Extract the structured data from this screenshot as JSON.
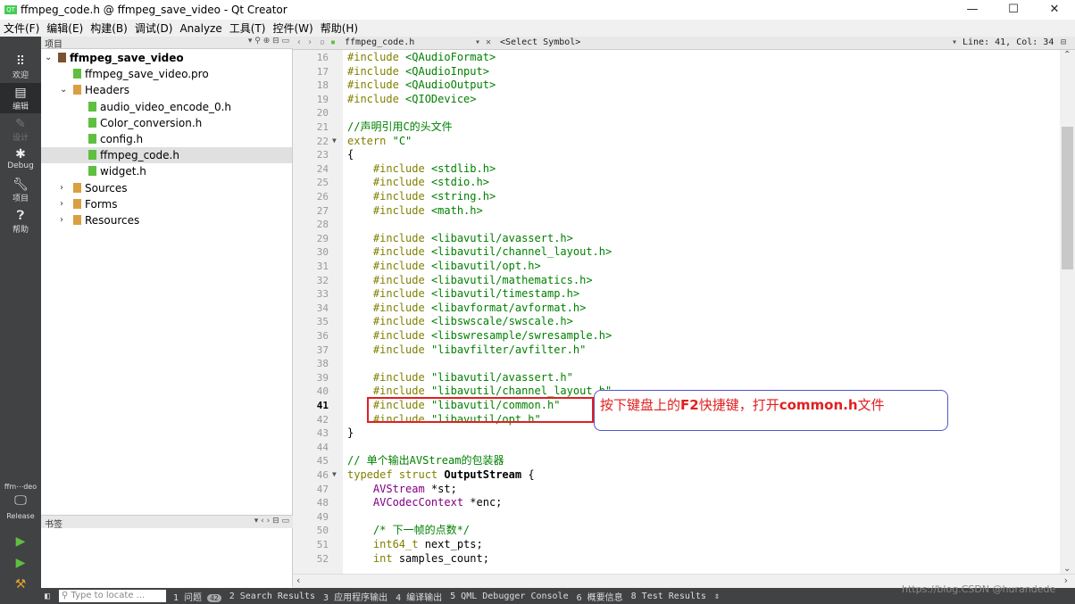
{
  "window": {
    "title": "ffmpeg_code.h @ ffmpeg_save_video - Qt Creator",
    "controls": [
      "—",
      "☐",
      "✕"
    ]
  },
  "menu": [
    "文件(F)",
    "编辑(E)",
    "构建(B)",
    "调试(D)",
    "Analyze",
    "工具(T)",
    "控件(W)",
    "帮助(H)"
  ],
  "modes": [
    {
      "label": "欢迎",
      "icon": "grid-icon"
    },
    {
      "label": "编辑",
      "icon": "edit-icon"
    },
    {
      "label": "设计",
      "icon": "design-icon"
    },
    {
      "label": "Debug",
      "icon": "bug-icon"
    },
    {
      "label": "项目",
      "icon": "wrench-icon"
    },
    {
      "label": "帮助",
      "icon": "help-icon"
    }
  ],
  "kit": {
    "project": "ffm⋯deo",
    "config": "Release"
  },
  "project_panel": {
    "title": "项目"
  },
  "tree": [
    {
      "label": "ffmpeg_save_video",
      "level": 0,
      "arrow": "⌄",
      "bold": true,
      "icon": "project-icon"
    },
    {
      "label": "ffmpeg_save_video.pro",
      "level": 1,
      "arrow": "",
      "icon": "pro-file-icon"
    },
    {
      "label": "Headers",
      "level": 1,
      "arrow": "⌄",
      "icon": "folder-icon"
    },
    {
      "label": "audio_video_encode_0.h",
      "level": 2,
      "arrow": "",
      "icon": "header-file-icon"
    },
    {
      "label": "Color_conversion.h",
      "level": 2,
      "arrow": "",
      "icon": "header-file-icon"
    },
    {
      "label": "config.h",
      "level": 2,
      "arrow": "",
      "icon": "header-file-icon"
    },
    {
      "label": "ffmpeg_code.h",
      "level": 2,
      "arrow": "",
      "icon": "header-file-icon",
      "selected": true
    },
    {
      "label": "widget.h",
      "level": 2,
      "arrow": "",
      "icon": "header-file-icon"
    },
    {
      "label": "Sources",
      "level": 1,
      "arrow": "›",
      "icon": "folder-icon"
    },
    {
      "label": "Forms",
      "level": 1,
      "arrow": "›",
      "icon": "folder-icon"
    },
    {
      "label": "Resources",
      "level": 1,
      "arrow": "›",
      "icon": "folder-icon"
    }
  ],
  "open_docs_panel": {
    "title": "书签"
  },
  "editor": {
    "filename": "ffmpeg_code.h",
    "symbol": "<Select Symbol>",
    "position": "Line: 41, Col: 34",
    "current_line": 41
  },
  "code_lines": [
    {
      "n": "16",
      "html": "<span class='kw'>#include</span> <span class='st'>&lt;QAudioFormat&gt;</span>"
    },
    {
      "n": "17",
      "html": "<span class='kw'>#include</span> <span class='st'>&lt;QAudioInput&gt;</span>"
    },
    {
      "n": "18",
      "html": "<span class='kw'>#include</span> <span class='st'>&lt;QAudioOutput&gt;</span>"
    },
    {
      "n": "19",
      "html": "<span class='kw'>#include</span> <span class='st'>&lt;QIODevice&gt;</span>"
    },
    {
      "n": "20",
      "html": ""
    },
    {
      "n": "21",
      "html": "<span class='cm'>//声明引用C的头文件</span>"
    },
    {
      "n": "22",
      "html": "<span class='kw'>extern</span> <span class='st'>\"C\"</span>",
      "fold": true
    },
    {
      "n": "23",
      "html": "{"
    },
    {
      "n": "24",
      "html": "    <span class='kw'>#include</span> <span class='st'>&lt;stdlib.h&gt;</span>"
    },
    {
      "n": "25",
      "html": "    <span class='kw'>#include</span> <span class='st'>&lt;stdio.h&gt;</span>"
    },
    {
      "n": "26",
      "html": "    <span class='kw'>#include</span> <span class='st'>&lt;string.h&gt;</span>"
    },
    {
      "n": "27",
      "html": "    <span class='kw'>#include</span> <span class='st'>&lt;math.h&gt;</span>"
    },
    {
      "n": "28",
      "html": ""
    },
    {
      "n": "29",
      "html": "    <span class='kw'>#include</span> <span class='st'>&lt;libavutil/avassert.h&gt;</span>"
    },
    {
      "n": "30",
      "html": "    <span class='kw'>#include</span> <span class='st'>&lt;libavutil/channel_layout.h&gt;</span>"
    },
    {
      "n": "31",
      "html": "    <span class='kw'>#include</span> <span class='st'>&lt;libavutil/opt.h&gt;</span>"
    },
    {
      "n": "32",
      "html": "    <span class='kw'>#include</span> <span class='st'>&lt;libavutil/mathematics.h&gt;</span>"
    },
    {
      "n": "33",
      "html": "    <span class='kw'>#include</span> <span class='st'>&lt;libavutil/timestamp.h&gt;</span>"
    },
    {
      "n": "34",
      "html": "    <span class='kw'>#include</span> <span class='st'>&lt;libavformat/avformat.h&gt;</span>"
    },
    {
      "n": "35",
      "html": "    <span class='kw'>#include</span> <span class='st'>&lt;libswscale/swscale.h&gt;</span>"
    },
    {
      "n": "36",
      "html": "    <span class='kw'>#include</span> <span class='st'>&lt;libswresample/swresample.h&gt;</span>"
    },
    {
      "n": "37",
      "html": "    <span class='kw'>#include</span> <span class='st'>\"libavfilter/avfilter.h\"</span>"
    },
    {
      "n": "38",
      "html": ""
    },
    {
      "n": "39",
      "html": "    <span class='kw'>#include</span> <span class='st'>\"libavutil/avassert.h\"</span>"
    },
    {
      "n": "40",
      "html": "    <span class='kw'>#include</span> <span class='st'>\"libavutil/channel_layout.h\"</span>"
    },
    {
      "n": "41",
      "html": "    <span class='kw'>#include</span> <span class='st'>\"libavutil/common.h\"</span>"
    },
    {
      "n": "42",
      "html": "    <span class='kw'>#include</span> <span class='st'>\"libavutil/opt.h\"</span>"
    },
    {
      "n": "43",
      "html": "}"
    },
    {
      "n": "44",
      "html": ""
    },
    {
      "n": "45",
      "html": "<span class='cm'>// 单个输出AVStream的包装器</span>"
    },
    {
      "n": "46",
      "html": "<span class='kw'>typedef</span> <span class='kw'>struct</span> <span class='bd'>OutputStream</span> {",
      "fold": true
    },
    {
      "n": "47",
      "html": "    <span class='ty'>AVStream</span> *st;"
    },
    {
      "n": "48",
      "html": "    <span class='ty'>AVCodecContext</span> *enc;"
    },
    {
      "n": "49",
      "html": ""
    },
    {
      "n": "50",
      "html": "    <span class='cm'>/* 下一帧的点数*/</span>"
    },
    {
      "n": "51",
      "html": "    <span class='kw'>int64_t</span> next_pts;"
    },
    {
      "n": "52",
      "html": "    <span class='kw'>int</span> samples_count;"
    }
  ],
  "annotation": {
    "before": "按下键盘上的",
    "key": "F2",
    "middle": "快捷键，打开",
    "file": "common.h",
    "after": "文件"
  },
  "status": {
    "locator_placeholder": "Type to locate ...",
    "tabs": [
      "1 问题",
      "2 Search Results",
      "3 应用程序输出",
      "4 编译输出",
      "5 QML Debugger Console",
      "6 概要信息",
      "8 Test Results"
    ],
    "issues_count": "42"
  },
  "watermark": "https://blog.CSDN @hurandede"
}
